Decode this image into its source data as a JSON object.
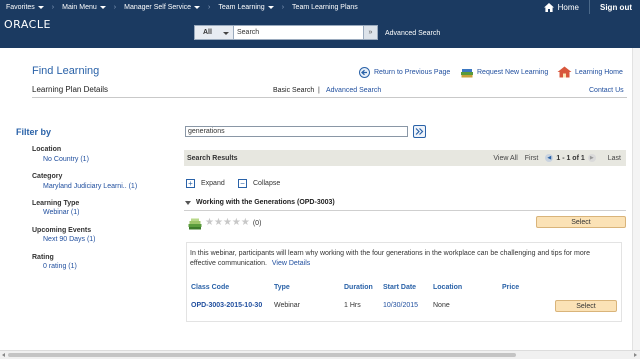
{
  "topnav": {
    "favorites": "Favorites",
    "main_menu": "Main Menu",
    "breadcrumbs": [
      "Manager Self Service",
      "Team Learning",
      "Team Learning Plans"
    ],
    "home": "Home",
    "sign_out": "Sign out"
  },
  "header": {
    "logo": "ORACLE",
    "search_scope": "All",
    "search_placeholder": "Search",
    "advanced_search": "Advanced Search"
  },
  "page": {
    "title": "Find Learning",
    "subtitle": "Learning Plan Details",
    "basic_search": "Basic Search",
    "separator": "|",
    "advanced_search": "Advanced Search",
    "return_link": "Return to Previous Page",
    "request_link": "Request New Learning",
    "learning_home": "Learning Home",
    "contact_us": "Contact Us"
  },
  "filters": {
    "heading": "Filter by",
    "facets": [
      {
        "label": "Location",
        "value": "No Country (1)"
      },
      {
        "label": "Category",
        "value": "Maryland Judiciary Learni.. (1)"
      },
      {
        "label": "Learning Type",
        "value": "Webinar (1)"
      },
      {
        "label": "Upcoming Events",
        "value": "Next 90 Days (1)"
      },
      {
        "label": "Rating",
        "value": "0 rating (1)"
      }
    ]
  },
  "query": {
    "value": "generations"
  },
  "results": {
    "title": "Search Results",
    "view_all": "View All",
    "first": "First",
    "range": "1 - 1 of 1",
    "last": "Last",
    "expand": "Expand",
    "collapse": "Collapse"
  },
  "item": {
    "title": "Working with the Generations (OPD-3003)",
    "rating_count": "(0)",
    "rating_stars": 0,
    "select_label": "Select",
    "description": "In this webinar, participants will learn why working with the four generations in the workplace can be challenging and tips for more effective communication.",
    "view_details": "View Details",
    "columns": [
      "Class Code",
      "Type",
      "Duration",
      "Start Date",
      "Location",
      "Price"
    ],
    "class_row": {
      "class_code": "OPD-3003-2015-10-30",
      "type": "Webinar",
      "duration": "1 Hrs",
      "start_date": "10/30/2015",
      "location": "None",
      "price": "",
      "select_label": "Select"
    }
  },
  "colors": {
    "nav_bg": "#1b3a61",
    "link": "#1f4e9e",
    "title": "#2a62a8",
    "select_button": "#fbe2b6",
    "results_bar": "#e7e7e0"
  }
}
